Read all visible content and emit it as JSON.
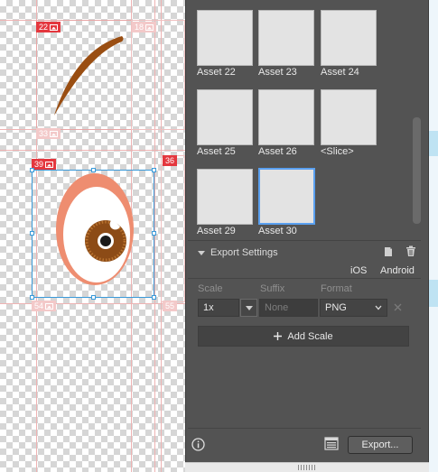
{
  "canvas": {
    "artboards": [
      {
        "id": "22",
        "badge": "22"
      },
      {
        "id": "18",
        "badge": "18"
      },
      {
        "id": "33",
        "badge": "33"
      },
      {
        "id": "39",
        "badge": "39"
      },
      {
        "id": "36",
        "badge": "36"
      },
      {
        "id": "54",
        "badge": "54"
      },
      {
        "id": "55",
        "badge": "55"
      }
    ],
    "eye_colors": {
      "outer": "#ee8d70",
      "white": "#ffffff",
      "iris": "#8c4b16",
      "pupil": "#1a1a1a",
      "brow": "#9a4e12"
    }
  },
  "asset_panel": {
    "assets": [
      {
        "label": "Asset 22"
      },
      {
        "label": "Asset 23"
      },
      {
        "label": "Asset 24"
      },
      {
        "label": "Asset 25"
      },
      {
        "label": "Asset 26"
      },
      {
        "label": "<Slice>"
      },
      {
        "label": "Asset 29"
      },
      {
        "label": "Asset 30",
        "selected": true
      }
    ],
    "export_settings": {
      "title": "Export Settings",
      "tabs": [
        "iOS",
        "Android"
      ],
      "columns": {
        "scale": "Scale",
        "suffix": "Suffix",
        "format": "Format"
      },
      "row": {
        "scale": "1x",
        "suffix_placeholder": "None",
        "format": "PNG"
      },
      "add_scale_label": "Add Scale"
    },
    "footer": {
      "export_label": "Export..."
    }
  },
  "colors": {
    "panel_bg": "#535353",
    "selection_accent": "#5aa0f0",
    "artboard_badge": "#e4373e"
  }
}
